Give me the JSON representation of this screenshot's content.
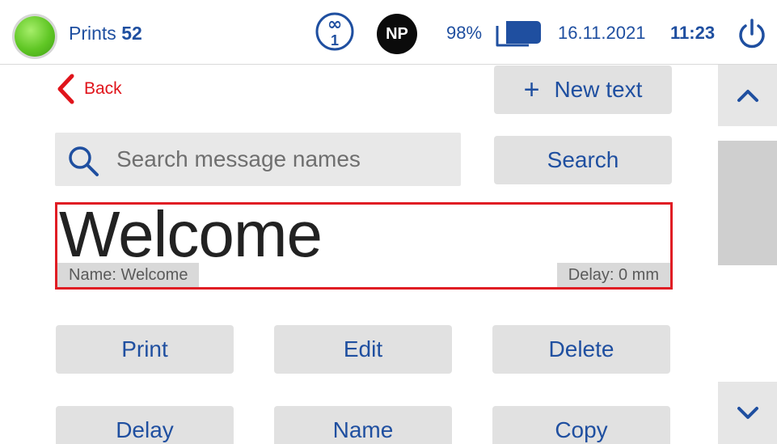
{
  "status_bar": {
    "prints_label": "Prints",
    "prints_count": "52",
    "counter_top": "∞",
    "counter_bottom": "1",
    "badge": "NP",
    "ink_level": "98%",
    "date": "16.11.2021",
    "time": "11:23",
    "status_color": "#5fc624"
  },
  "navigation": {
    "back_label": "Back"
  },
  "toolbar": {
    "new_text_plus": "+",
    "new_text_label": "New text",
    "search_label": "Search"
  },
  "search": {
    "placeholder": "Search message names",
    "value": ""
  },
  "message": {
    "preview_text": "Welcome",
    "name_tag": "Name: Welcome",
    "delay_tag": "Delay: 0 mm",
    "selected_border_color": "#e01d24"
  },
  "actions": [
    {
      "label": "Print"
    },
    {
      "label": "Edit"
    },
    {
      "label": "Delete"
    },
    {
      "label": "Delay"
    },
    {
      "label": "Name"
    },
    {
      "label": "Copy"
    }
  ],
  "icons": {
    "status": "status-indicator-icon",
    "counter": "infinity-counter-icon",
    "cartridge": "ink-cartridge-icon",
    "power": "power-icon",
    "back": "chevron-left-icon",
    "search": "search-icon",
    "scroll_up": "chevron-up-icon",
    "scroll_down": "chevron-down-icon"
  },
  "colors": {
    "accent": "#1f4fa0",
    "back_red": "#e0141b",
    "button_bg": "#e1e1e1"
  }
}
